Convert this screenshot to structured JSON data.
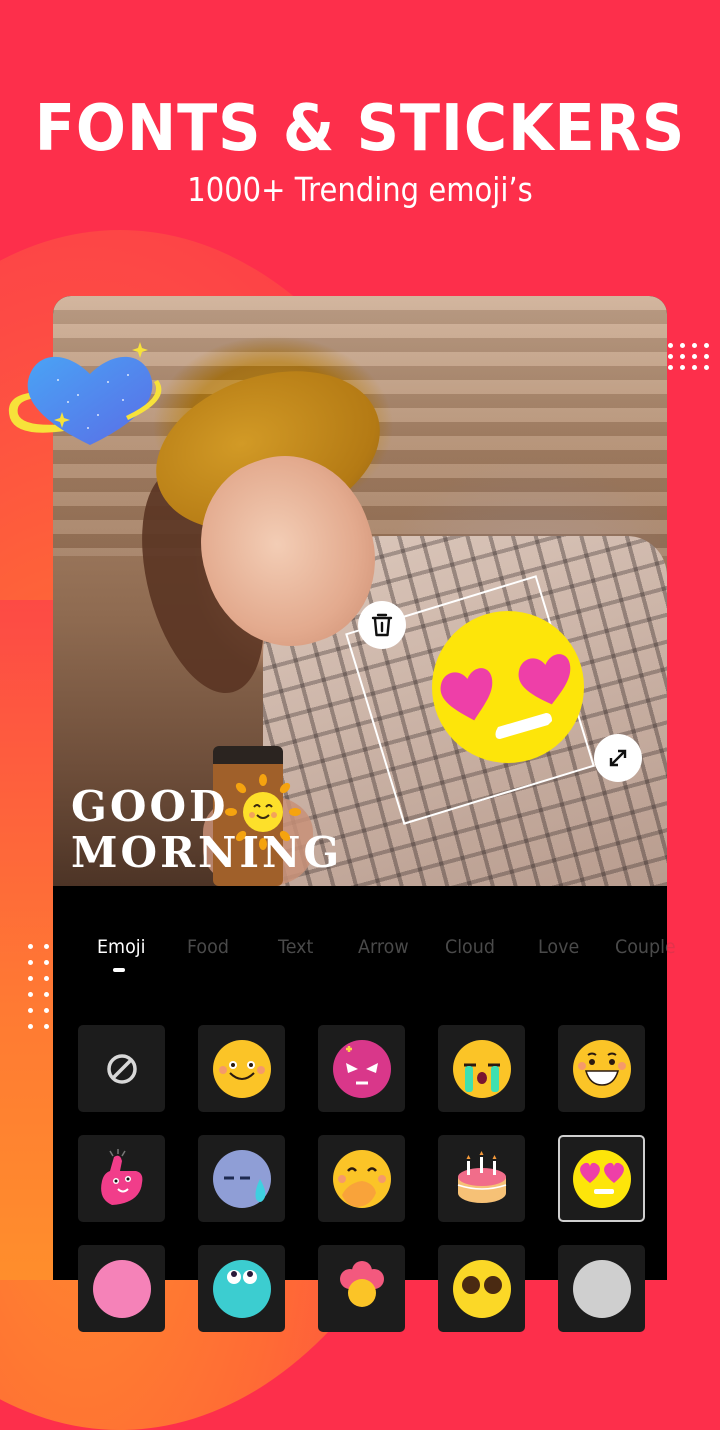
{
  "header": {
    "title": "FONTS & STICKERS",
    "subtitle": "1000+ Trending emoji’s"
  },
  "colors": {
    "background_red": "#fd2f4b",
    "accent_orange": "#ff8a2e",
    "panel_black": "#000000",
    "cell_bg": "#1c1c1c",
    "tab_inactive": "#4a4a4a",
    "tab_active": "#ffffff"
  },
  "canvas": {
    "text_overlay": {
      "line1": "GOOD",
      "line2": "MORNING"
    },
    "stickers": [
      {
        "name": "heart-planet-sticker",
        "icon": "blue-heart-planet"
      },
      {
        "name": "sun-sticker",
        "icon": "smiling-sun"
      },
      {
        "name": "heart-eyes-sticker",
        "icon": "heart-eyes-emoji",
        "selected": true
      }
    ],
    "handles": {
      "delete_icon": "trash-icon",
      "resize_icon": "resize-arrows-icon"
    }
  },
  "tabs": [
    {
      "label": "Emoji",
      "active": true
    },
    {
      "label": "Food",
      "active": false
    },
    {
      "label": "Text",
      "active": false
    },
    {
      "label": "Arrow",
      "active": false
    },
    {
      "label": "Cloud",
      "active": false
    },
    {
      "label": "Love",
      "active": false
    },
    {
      "label": "Couple",
      "active": false
    }
  ],
  "sticker_grid": [
    {
      "icon": "none-icon",
      "selected": false
    },
    {
      "icon": "smiling-face",
      "selected": false
    },
    {
      "icon": "angry-pink-face",
      "selected": false
    },
    {
      "icon": "crying-face",
      "selected": false
    },
    {
      "icon": "grinning-face",
      "selected": false
    },
    {
      "icon": "pink-thumbs-up",
      "selected": false
    },
    {
      "icon": "sweat-face",
      "selected": false
    },
    {
      "icon": "hand-over-mouth-face",
      "selected": false
    },
    {
      "icon": "birthday-cake",
      "selected": false
    },
    {
      "icon": "heart-eyes-face",
      "selected": true
    },
    {
      "icon": "pink-face",
      "selected": false
    },
    {
      "icon": "teal-looking-up-face",
      "selected": false
    },
    {
      "icon": "flower-face",
      "selected": false
    },
    {
      "icon": "sunglasses-face",
      "selected": false
    },
    {
      "icon": "gray-face",
      "selected": false
    }
  ]
}
